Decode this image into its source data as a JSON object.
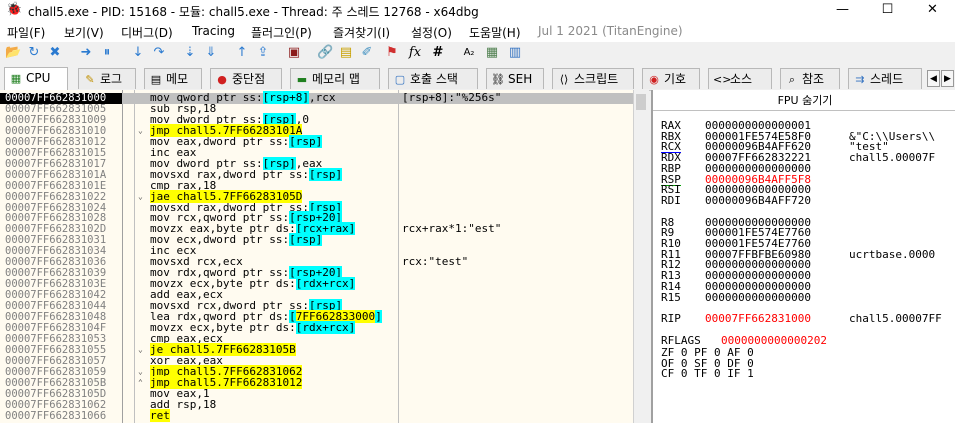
{
  "window": {
    "title": "chall5.exe - PID: 15168 - 모듈: chall5.exe - Thread: 주 스레드 12768 - x64dbg",
    "app_icon": "bug-icon",
    "minimize": "—",
    "maximize": "☐",
    "close": "✕"
  },
  "menu": {
    "items": [
      "파일(F)",
      "보기(V)",
      "디버그(D)",
      "Tracing",
      "플러그인(P)",
      "즐겨찾기(I)",
      "설정(O)",
      "도움말(H)"
    ],
    "date": "Jul 1 2021 (TitanEngine)"
  },
  "toolbar": {
    "icons": [
      "open-icon",
      "restart-icon",
      "close-icon",
      "run-icon",
      "pause-icon",
      "step-into-icon",
      "step-over-icon",
      "trace-into-icon",
      "trace-over-icon",
      "execute-till-return-icon",
      "run-to-user-code-icon",
      "scylla-icon",
      "patch-icon",
      "comment-icon",
      "label-icon",
      "bookmark-icon",
      "function-icon",
      "hash-icon",
      "font-icon",
      "calc-icon",
      "strings-icon"
    ],
    "glyphs": [
      "📂",
      "↻",
      "✖",
      "➜",
      "⏸",
      "↓",
      "↷",
      "⇣",
      "⇓",
      "↑",
      "⇪",
      "▣",
      "🔗",
      "▤",
      "✐",
      "⚑",
      "fx",
      "#",
      "A₂",
      "▦",
      "▥"
    ]
  },
  "tabs": [
    {
      "label": "CPU",
      "icon": "cpu-icon",
      "glyph": "▦"
    },
    {
      "label": "로그",
      "icon": "log-icon",
      "glyph": "✎"
    },
    {
      "label": "메모",
      "icon": "notes-icon",
      "glyph": "▤"
    },
    {
      "label": "중단점",
      "icon": "breakpoint-icon",
      "glyph": "●"
    },
    {
      "label": "메모리 맵",
      "icon": "memory-map-icon",
      "glyph": "▬"
    },
    {
      "label": "호출 스택",
      "icon": "call-stack-icon",
      "glyph": "▢"
    },
    {
      "label": "SEH",
      "icon": "seh-icon",
      "glyph": "⛓"
    },
    {
      "label": "스크립트",
      "icon": "script-icon",
      "glyph": "⟨⟩"
    },
    {
      "label": "기호",
      "icon": "symbols-icon",
      "glyph": "◉"
    },
    {
      "label": "소스",
      "icon": "source-icon",
      "glyph": "<>"
    },
    {
      "label": "참조",
      "icon": "references-icon",
      "glyph": "⌕"
    },
    {
      "label": "스레드",
      "icon": "threads-icon",
      "glyph": "⇉"
    }
  ],
  "disasm": {
    "rows": [
      {
        "addr": "00007FF662831000",
        "arrow": "",
        "instr": "mov qword ptr ss:[rsp+8],rcx",
        "comment": "[rsp+8]:\"%256s\"",
        "jmp": false,
        "selected": true
      },
      {
        "addr": "00007FF662831005",
        "arrow": "",
        "instr": "sub rsp,18",
        "comment": "",
        "jmp": false
      },
      {
        "addr": "00007FF662831009",
        "arrow": "",
        "instr": "mov dword ptr ss:[rsp],0",
        "comment": "",
        "jmp": false
      },
      {
        "addr": "00007FF662831010",
        "arrow": "v",
        "instr": "jmp chall5.7FF66283101A",
        "comment": "",
        "jmp": true
      },
      {
        "addr": "00007FF662831012",
        "arrow": "",
        "instr": "mov eax,dword ptr ss:[rsp]",
        "comment": "",
        "jmp": false
      },
      {
        "addr": "00007FF662831015",
        "arrow": "",
        "instr": "inc eax",
        "comment": "",
        "jmp": false
      },
      {
        "addr": "00007FF662831017",
        "arrow": "",
        "instr": "mov dword ptr ss:[rsp],eax",
        "comment": "",
        "jmp": false
      },
      {
        "addr": "00007FF66283101A",
        "arrow": "",
        "instr": "movsxd rax,dword ptr ss:[rsp]",
        "comment": "",
        "jmp": false
      },
      {
        "addr": "00007FF66283101E",
        "arrow": "",
        "instr": "cmp rax,18",
        "comment": "",
        "jmp": false
      },
      {
        "addr": "00007FF662831022",
        "arrow": "v",
        "instr": "jae chall5.7FF66283105D",
        "comment": "",
        "jmp": true
      },
      {
        "addr": "00007FF662831024",
        "arrow": "",
        "instr": "movsxd rax,dword ptr ss:[rsp]",
        "comment": "",
        "jmp": false
      },
      {
        "addr": "00007FF662831028",
        "arrow": "",
        "instr": "mov rcx,qword ptr ss:[rsp+20]",
        "comment": "",
        "jmp": false
      },
      {
        "addr": "00007FF66283102D",
        "arrow": "",
        "instr": "movzx eax,byte ptr ds:[rcx+rax]",
        "comment": "rcx+rax*1:\"est\"",
        "jmp": false
      },
      {
        "addr": "00007FF662831031",
        "arrow": "",
        "instr": "mov ecx,dword ptr ss:[rsp]",
        "comment": "",
        "jmp": false
      },
      {
        "addr": "00007FF662831034",
        "arrow": "",
        "instr": "inc ecx",
        "comment": "",
        "jmp": false
      },
      {
        "addr": "00007FF662831036",
        "arrow": "",
        "instr": "movsxd rcx,ecx",
        "comment": "rcx:\"test\"",
        "jmp": false
      },
      {
        "addr": "00007FF662831039",
        "arrow": "",
        "instr": "mov rdx,qword ptr ss:[rsp+20]",
        "comment": "",
        "jmp": false
      },
      {
        "addr": "00007FF66283103E",
        "arrow": "",
        "instr": "movzx ecx,byte ptr ds:[rdx+rcx]",
        "comment": "",
        "jmp": false
      },
      {
        "addr": "00007FF662831042",
        "arrow": "",
        "instr": "add eax,ecx",
        "comment": "",
        "jmp": false
      },
      {
        "addr": "00007FF662831044",
        "arrow": "",
        "instr": "movsxd rcx,dword ptr ss:[rsp]",
        "comment": "",
        "jmp": false
      },
      {
        "addr": "00007FF662831048",
        "arrow": "",
        "instr": "lea rdx,qword ptr ds:[7FF662833000]",
        "comment": "",
        "jmp": false
      },
      {
        "addr": "00007FF66283104F",
        "arrow": "",
        "instr": "movzx ecx,byte ptr ds:[rdx+rcx]",
        "comment": "",
        "jmp": false
      },
      {
        "addr": "00007FF662831053",
        "arrow": "",
        "instr": "cmp eax,ecx",
        "comment": "",
        "jmp": false
      },
      {
        "addr": "00007FF662831055",
        "arrow": "v",
        "instr": "je chall5.7FF66283105B",
        "comment": "",
        "jmp": true
      },
      {
        "addr": "00007FF662831057",
        "arrow": "",
        "instr": "xor eax,eax",
        "comment": "",
        "jmp": false
      },
      {
        "addr": "00007FF662831059",
        "arrow": "v",
        "instr": "jmp chall5.7FF662831062",
        "comment": "",
        "jmp": true
      },
      {
        "addr": "00007FF66283105B",
        "arrow": "^",
        "instr": "jmp chall5.7FF662831012",
        "comment": "",
        "jmp": true
      },
      {
        "addr": "00007FF66283105D",
        "arrow": "",
        "instr": "mov eax,1",
        "comment": "",
        "jmp": false
      },
      {
        "addr": "00007FF662831062",
        "arrow": "",
        "instr": "add rsp,18",
        "comment": "",
        "jmp": false
      },
      {
        "addr": "00007FF662831066",
        "arrow": "",
        "instr": "ret",
        "comment": "",
        "jmp": false,
        "ret": true
      }
    ]
  },
  "fpu": {
    "header": "FPU 숨기기"
  },
  "registers": {
    "rows": [
      {
        "name": "RAX",
        "value": "0000000000000001",
        "comment": ""
      },
      {
        "name": "RBX",
        "value": "000001FE574E58F0",
        "comment": "&\"C:\\\\Users\\\\"
      },
      {
        "name": "RCX",
        "value": "00000096B4AFF620",
        "comment": "\"test\"",
        "underline": "blue"
      },
      {
        "name": "RDX",
        "value": "00007FF662832221",
        "comment": "chall5.00007F"
      },
      {
        "name": "RBP",
        "value": "0000000000000000",
        "comment": ""
      },
      {
        "name": "RSP",
        "value": "00000096B4AFF5F8",
        "comment": "",
        "red": true,
        "underline": "green"
      },
      {
        "name": "RSI",
        "value": "0000000000000000",
        "comment": ""
      },
      {
        "name": "RDI",
        "value": "00000096B4AFF720",
        "comment": ""
      },
      {
        "name": "R8",
        "value": "0000000000000000",
        "comment": "",
        "gap": true
      },
      {
        "name": "R9",
        "value": "000001FE574E7760",
        "comment": ""
      },
      {
        "name": "R10",
        "value": "000001FE574E7760",
        "comment": ""
      },
      {
        "name": "R11",
        "value": "00007FFBFBE60980",
        "comment": "ucrtbase.0000"
      },
      {
        "name": "R12",
        "value": "0000000000000000",
        "comment": ""
      },
      {
        "name": "R13",
        "value": "0000000000000000",
        "comment": ""
      },
      {
        "name": "R14",
        "value": "0000000000000000",
        "comment": ""
      },
      {
        "name": "R15",
        "value": "0000000000000000",
        "comment": ""
      },
      {
        "name": "RIP",
        "value": "00007FF662831000",
        "comment": "chall5.00007FF",
        "red": true,
        "gap": true
      }
    ],
    "rflags_label": "RFLAGS",
    "rflags_value": "0000000000000202",
    "flags": [
      "ZF 0  PF 0  AF 0",
      "OF 0  SF 0  DF 0",
      "CF 0  TF 0  IF 1"
    ]
  },
  "colors": {
    "jump_highlight": "#ffff00",
    "memory_highlight": "#00ffff",
    "register_changed": "#ff0000",
    "disasm_bg": "#fffbf0"
  }
}
